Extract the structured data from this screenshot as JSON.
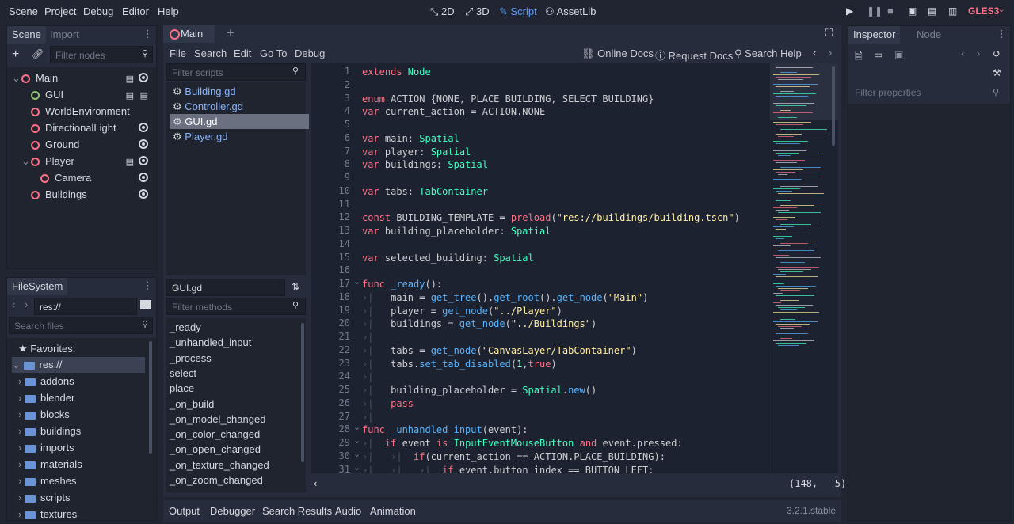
{
  "menu": [
    "Scene",
    "Project",
    "Debug",
    "Editor",
    "Help"
  ],
  "workspaces": [
    {
      "label": "2D",
      "icon": "2d-icon"
    },
    {
      "label": "3D",
      "icon": "3d-icon"
    },
    {
      "label": "Script",
      "icon": "script-icon"
    },
    {
      "label": "AssetLib",
      "icon": "assetlib-icon"
    }
  ],
  "renderer": "GLES3",
  "scene_tabs": {
    "scene": "Scene",
    "import": "Import"
  },
  "filter_nodes_placeholder": "Filter nodes",
  "scene_tree": [
    {
      "label": "Main",
      "depth": 0,
      "arrow": "⌄"
    },
    {
      "label": "GUI",
      "depth": 1
    },
    {
      "label": "WorldEnvironment",
      "depth": 1
    },
    {
      "label": "DirectionalLight",
      "depth": 1
    },
    {
      "label": "Ground",
      "depth": 1
    },
    {
      "label": "Player",
      "depth": 1,
      "arrow": "⌄"
    },
    {
      "label": "Camera",
      "depth": 2
    },
    {
      "label": "Buildings",
      "depth": 1
    }
  ],
  "filesystem": {
    "title": "FileSystem",
    "path": "res://",
    "search_placeholder": "Search files",
    "favorites": "Favorites:",
    "root": "res://",
    "folders": [
      "addons",
      "blender",
      "blocks",
      "buildings",
      "imports",
      "materials",
      "meshes",
      "scripts",
      "textures"
    ]
  },
  "editor_tab": "Main",
  "script_menu": [
    "File",
    "Search",
    "Edit",
    "Go To",
    "Debug"
  ],
  "doc_buttons": {
    "online": "Online Docs",
    "request": "Request Docs",
    "search": "Search Help"
  },
  "filter_scripts_placeholder": "Filter scripts",
  "scripts": [
    "Building.gd",
    "Controller.gd",
    "GUI.gd",
    "Player.gd"
  ],
  "current_script": "GUI.gd",
  "filter_methods_placeholder": "Filter methods",
  "methods": [
    "_ready",
    "_unhandled_input",
    "_process",
    "select",
    "place",
    "_on_build",
    "_on_model_changed",
    "_on_color_changed",
    "_on_open_changed",
    "_on_texture_changed",
    "_on_zoom_changed"
  ],
  "cursor": "(148,   5)",
  "code": [
    {
      "n": "1",
      "t": [
        [
          "kw",
          "extends "
        ],
        [
          "ty",
          "Node"
        ]
      ]
    },
    {
      "n": "2",
      "t": []
    },
    {
      "n": "3",
      "t": [
        [
          "kw",
          "enum "
        ],
        [
          "plain",
          "ACTION {NONE, PLACE_BUILDING, SELECT_BUILDING}"
        ]
      ]
    },
    {
      "n": "4",
      "t": [
        [
          "kw",
          "var "
        ],
        [
          "plain",
          "current_action = ACTION.NONE"
        ]
      ]
    },
    {
      "n": "5",
      "t": []
    },
    {
      "n": "6",
      "t": [
        [
          "kw",
          "var "
        ],
        [
          "plain",
          "main: "
        ],
        [
          "ty",
          "Spatial"
        ]
      ]
    },
    {
      "n": "7",
      "t": [
        [
          "kw",
          "var "
        ],
        [
          "plain",
          "player: "
        ],
        [
          "ty",
          "Spatial"
        ]
      ]
    },
    {
      "n": "8",
      "t": [
        [
          "kw",
          "var "
        ],
        [
          "plain",
          "buildings: "
        ],
        [
          "ty",
          "Spatial"
        ]
      ]
    },
    {
      "n": "9",
      "t": []
    },
    {
      "n": "10",
      "t": [
        [
          "kw",
          "var "
        ],
        [
          "plain",
          "tabs: "
        ],
        [
          "ty",
          "TabContainer"
        ]
      ]
    },
    {
      "n": "11",
      "t": []
    },
    {
      "n": "12",
      "t": [
        [
          "kw",
          "const "
        ],
        [
          "plain",
          "BUILDING_TEMPLATE = "
        ],
        [
          "kw",
          "preload"
        ],
        [
          "plain",
          "("
        ],
        [
          "str",
          "\"res://buildings/building.tscn\""
        ],
        [
          "plain",
          ")"
        ]
      ]
    },
    {
      "n": "13",
      "t": [
        [
          "kw",
          "var "
        ],
        [
          "plain",
          "building_placeholder: "
        ],
        [
          "ty",
          "Spatial"
        ]
      ]
    },
    {
      "n": "14",
      "t": []
    },
    {
      "n": "15",
      "t": [
        [
          "kw",
          "var "
        ],
        [
          "plain",
          "selected_building: "
        ],
        [
          "ty",
          "Spatial"
        ]
      ]
    },
    {
      "n": "16",
      "t": []
    },
    {
      "n": "17",
      "f": "⌄",
      "t": [
        [
          "kw",
          "func "
        ],
        [
          "fn",
          "_ready"
        ],
        [
          "plain",
          "():"
        ]
      ]
    },
    {
      "n": "18",
      "t": [
        [
          "tabind",
          "›|   "
        ],
        [
          "plain",
          "main = "
        ],
        [
          "fn",
          "get_tree"
        ],
        [
          "plain",
          "()."
        ],
        [
          "fn",
          "get_root"
        ],
        [
          "plain",
          "()."
        ],
        [
          "fn",
          "get_node"
        ],
        [
          "plain",
          "("
        ],
        [
          "str",
          "\"Main\""
        ],
        [
          "plain",
          ")"
        ]
      ]
    },
    {
      "n": "19",
      "t": [
        [
          "tabind",
          "›|   "
        ],
        [
          "plain",
          "player = "
        ],
        [
          "fn",
          "get_node"
        ],
        [
          "plain",
          "("
        ],
        [
          "str",
          "\"../Player\""
        ],
        [
          "plain",
          ")"
        ]
      ]
    },
    {
      "n": "20",
      "t": [
        [
          "tabind",
          "›|   "
        ],
        [
          "plain",
          "buildings = "
        ],
        [
          "fn",
          "get_node"
        ],
        [
          "plain",
          "("
        ],
        [
          "str",
          "\"../Buildings\""
        ],
        [
          "plain",
          ")"
        ]
      ]
    },
    {
      "n": "21",
      "t": [
        [
          "tabind",
          "›|"
        ]
      ]
    },
    {
      "n": "22",
      "t": [
        [
          "tabind",
          "›|   "
        ],
        [
          "plain",
          "tabs = "
        ],
        [
          "fn",
          "get_node"
        ],
        [
          "plain",
          "("
        ],
        [
          "str",
          "\"CanvasLayer/TabContainer\""
        ],
        [
          "plain",
          ")"
        ]
      ]
    },
    {
      "n": "23",
      "t": [
        [
          "tabind",
          "›|   "
        ],
        [
          "plain",
          "tabs."
        ],
        [
          "fn",
          "set_tab_disabled"
        ],
        [
          "plain",
          "("
        ],
        [
          "num",
          "1"
        ],
        [
          "plain",
          ","
        ],
        [
          "kw",
          "true"
        ],
        [
          "plain",
          ")"
        ]
      ]
    },
    {
      "n": "24",
      "t": [
        [
          "tabind",
          "›|"
        ]
      ]
    },
    {
      "n": "25",
      "t": [
        [
          "tabind",
          "›|   "
        ],
        [
          "plain",
          "building_placeholder = "
        ],
        [
          "ty",
          "Spatial"
        ],
        [
          "plain",
          "."
        ],
        [
          "fn",
          "new"
        ],
        [
          "plain",
          "()"
        ]
      ]
    },
    {
      "n": "26",
      "t": [
        [
          "tabind",
          "›|   "
        ],
        [
          "kw",
          "pass"
        ]
      ]
    },
    {
      "n": "27",
      "t": [
        [
          "tabind",
          "›|"
        ]
      ]
    },
    {
      "n": "28",
      "f": "⌄",
      "t": [
        [
          "kw",
          "func "
        ],
        [
          "fn",
          "_unhandled_input"
        ],
        [
          "plain",
          "(event):"
        ]
      ]
    },
    {
      "n": "29",
      "f": "⌄",
      "t": [
        [
          "tabind",
          "›|  "
        ],
        [
          "kw",
          "if "
        ],
        [
          "plain",
          "event "
        ],
        [
          "kw",
          "is "
        ],
        [
          "ty",
          "InputEventMouseButton "
        ],
        [
          "kw",
          "and "
        ],
        [
          "plain",
          "event.pressed:"
        ]
      ]
    },
    {
      "n": "30",
      "f": "⌄",
      "t": [
        [
          "tabind",
          "›|   ›|  "
        ],
        [
          "kw",
          "if"
        ],
        [
          "plain",
          "(current_action == ACTION.PLACE_BUILDING):"
        ]
      ]
    },
    {
      "n": "31",
      "f": "⌄",
      "t": [
        [
          "tabind",
          "›|   ›|   ›|  "
        ],
        [
          "kw",
          "if "
        ],
        [
          "plain",
          "event.button_index == BUTTON_LEFT:"
        ]
      ]
    }
  ],
  "inspector": {
    "tab": "Inspector",
    "node_tab": "Node",
    "filter_placeholder": "Filter properties"
  },
  "bottom_tabs": [
    "Output",
    "Debugger",
    "Search Results",
    "Audio",
    "Animation"
  ],
  "version": "3.2.1.stable"
}
